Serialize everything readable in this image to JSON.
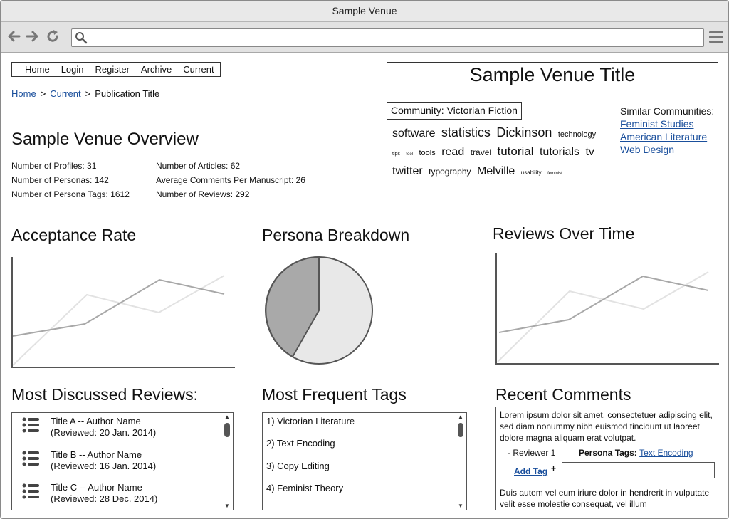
{
  "window": {
    "title": "Sample Venue"
  },
  "browser": {
    "url_value": "",
    "url_placeholder": ""
  },
  "nav": {
    "items": [
      "Home",
      "Login",
      "Register",
      "Archive",
      "Current"
    ]
  },
  "breadcrumb": {
    "home": "Home",
    "current": "Current",
    "page": "Publication Title",
    "separator": ">"
  },
  "venue": {
    "title": "Sample Venue Title"
  },
  "community": {
    "label": "Community: Victorian Fiction",
    "tags": [
      {
        "text": "software",
        "size": 16
      },
      {
        "text": "statistics",
        "size": 18
      },
      {
        "text": "Dickinson",
        "size": 18
      },
      {
        "text": "technology",
        "size": 11
      },
      {
        "text": "tips",
        "size": 7
      },
      {
        "text": "tool",
        "size": 6
      },
      {
        "text": "tools",
        "size": 11
      },
      {
        "text": "read",
        "size": 16
      },
      {
        "text": "travel",
        "size": 12
      },
      {
        "text": "tutorial",
        "size": 17
      },
      {
        "text": "tutorials",
        "size": 16
      },
      {
        "text": "tv",
        "size": 16
      },
      {
        "text": "twitter",
        "size": 16
      },
      {
        "text": "typography",
        "size": 12
      },
      {
        "text": "Melville",
        "size": 16
      },
      {
        "text": "usability",
        "size": 8
      },
      {
        "text": "feminist",
        "size": 6
      }
    ]
  },
  "similar": {
    "heading": "Similar Communities:",
    "links": [
      "Feminist Studies",
      "American Literature",
      "Web Design"
    ]
  },
  "overview": {
    "title": "Sample Venue Overview",
    "left": [
      "Number of Profiles: 31",
      "Number of Personas: 142",
      "Number of Persona Tags: 1612"
    ],
    "right": [
      "Number of Articles: 62",
      "Average Comments Per Manuscript: 26",
      "Number of Reviews: 292"
    ]
  },
  "sections": {
    "acceptance": "Acceptance Rate",
    "persona": "Persona Breakdown",
    "reviews_time": "Reviews Over Time",
    "most_discussed": "Most Discussed Reviews:",
    "frequent_tags": "Most Frequent Tags",
    "recent_comments": "Recent Comments"
  },
  "colors": {
    "link": "#1a4f9c",
    "dark_series": "#a8a8a8",
    "light_series": "#e2e2e2",
    "pie_dark": "#a9a9a9",
    "pie_light": "#e8e8e8"
  },
  "most_discussed": [
    {
      "title": "Title A -- Author Name",
      "date": "(Reviewed: 20 Jan. 2014)"
    },
    {
      "title": "Title B -- Author Name",
      "date": "(Reviewed: 16 Jan. 2014)"
    },
    {
      "title": "Title C -- Author Name",
      "date": "(Reviewed: 28 Dec. 2014)"
    }
  ],
  "frequent_tags": [
    "1) Victorian Literature",
    "2) Text Encoding",
    "3) Copy Editing",
    "4) Feminist Theory"
  ],
  "comments": {
    "first": "Lorem ipsum dolor sit amet, consectetuer adipiscing elit, sed diam nonummy nibh euismod tincidunt ut laoreet dolore magna aliquam erat volutpat.",
    "reviewer": "- Reviewer 1",
    "persona_tags_label": "Persona Tags:",
    "persona_tag": "Text Encoding",
    "add_tag": "Add Tag",
    "add_plus": "+",
    "tag_input_value": "",
    "second": "Duis autem vel eum iriure dolor in hendrerit in vulputate velit esse molestie consequat, vel illum"
  }
}
